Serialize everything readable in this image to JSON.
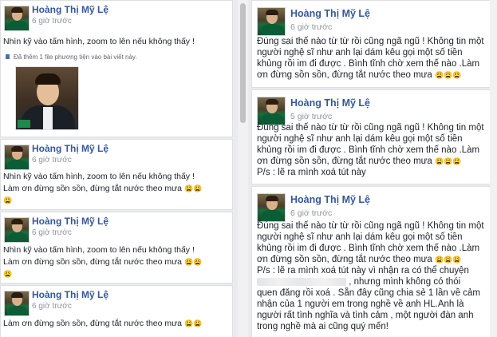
{
  "author": "Hoàng Thị Mỹ Lệ",
  "emoji_sad": "😩",
  "left": {
    "post1": {
      "time": "6 giờ trước",
      "text": "Nhìn kỹ vào tấm hình, zoom to lên nếu không thấy !",
      "attach_note": "Đã thêm 1 file phương tiện vào bài viết này."
    },
    "post2": {
      "time": "6 giờ trước",
      "line1": "Nhìn kỹ vào tấm hình, zoom to lên nếu không thấy !",
      "line2": "Làm ơn đừng sồn sồn, đừng tắt nước theo mưa"
    },
    "post3": {
      "time": "6 giờ trước",
      "line1": "Nhìn kỹ vào tấm hình, zoom to lên nếu không thấy !",
      "line2": "Làm ơn đừng sồn sồn, đừng tắt nước theo mưa"
    },
    "post4": {
      "time": "6 giờ trước",
      "line1": "Làm ơn đừng sồn sồn, đừng tắt nước theo mưa"
    }
  },
  "right": {
    "post1": {
      "time": "6 giờ trước",
      "line1": "Đúng sai thế nào từ từ rồi cũng ngã ngũ ! Không tin một",
      "line2": "người nghệ sĩ như anh lại dám kêu gọi một số tiền",
      "line3": "khủng rồi im đi được . Bình tĩnh chờ xem thế nào .Làm",
      "line4": "ơn đừng sồn sồn, đừng tắt nước theo mưa"
    },
    "post2": {
      "time": "5 giờ trước",
      "line1": "Đúng sai thế nào từ từ rồi cũng ngã ngũ ! Không tin một",
      "line2": "người nghệ sĩ như anh lại dám kêu gọi một số tiền",
      "line3": "khủng rồi im đi được . Bình tĩnh chờ xem thế nào .Làm",
      "line4": "ơn đừng sồn sồn, đừng tắt nước theo mưa",
      "line5": "P/s : lẽ ra mình xoá tút này"
    },
    "post3": {
      "time": "6 giờ trước",
      "line1": "Đúng sai thế nào từ từ rồi cũng ngã ngũ ! Không tin một",
      "line2": "người nghệ sĩ như anh lại dám kêu gọi một số tiền",
      "line3": "khủng rồi im đi được . Bình tĩnh chờ xem thế nào .Làm",
      "line4": "ơn đừng sồn sồn, đừng tắt nước theo mưa",
      "line5": "P/s : lẽ ra mình xoá tút này vì nhận ra có thể chuyện",
      "line6": ", nhưng mình không có thói",
      "line7": "quen đăng rồi xoá . Sẵn đây cũng chia sẻ 1 lần về cảm",
      "line8": "nhận của 1 người em trong nghề về anh HL.Anh là",
      "line9": "người rất tình nghĩa và tình cảm , một người đàn anh",
      "line10": "trong nghề mà ai cũng quý mến!"
    }
  }
}
